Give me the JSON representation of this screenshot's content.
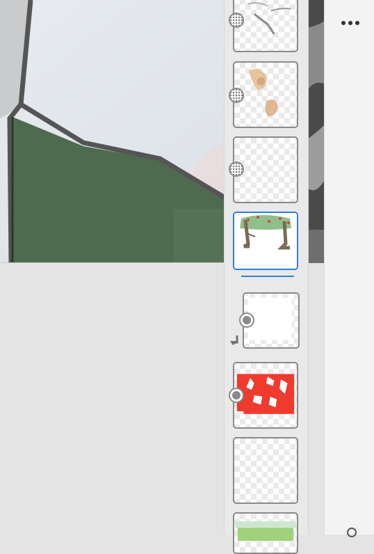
{
  "app": {
    "canvas": {
      "description_icon": "painting-canvas"
    },
    "layers_panel": {
      "layers": [
        {
          "id": 1,
          "thumbnail": "gray-strokes",
          "icon": "texture-dots",
          "selected": false
        },
        {
          "id": 2,
          "thumbnail": "tan-strokes",
          "icon": "texture-dots",
          "selected": false
        },
        {
          "id": 3,
          "thumbnail": "empty",
          "icon": "texture-dots",
          "selected": false
        },
        {
          "id": 4,
          "thumbnail": "trees-with-apples",
          "icon": "",
          "selected": true
        },
        {
          "id": 5,
          "thumbnail": "white-blank",
          "icon": "radio-dot",
          "selected": false,
          "clipped": true
        },
        {
          "id": 6,
          "thumbnail": "red-shape",
          "icon": "radio-dot",
          "selected": false
        },
        {
          "id": 7,
          "thumbnail": "empty",
          "icon": "",
          "selected": false
        },
        {
          "id": 8,
          "thumbnail": "green-field",
          "icon": "",
          "selected": false
        }
      ]
    },
    "sidebar": {
      "more_icon": "more-horizontal-icon",
      "search_icon": "search-icon"
    },
    "colors": {
      "selection_blue": "#2f7fd6",
      "panel_bg": "#e9e9e9",
      "sidebar_bg": "#f3f3f3"
    }
  }
}
